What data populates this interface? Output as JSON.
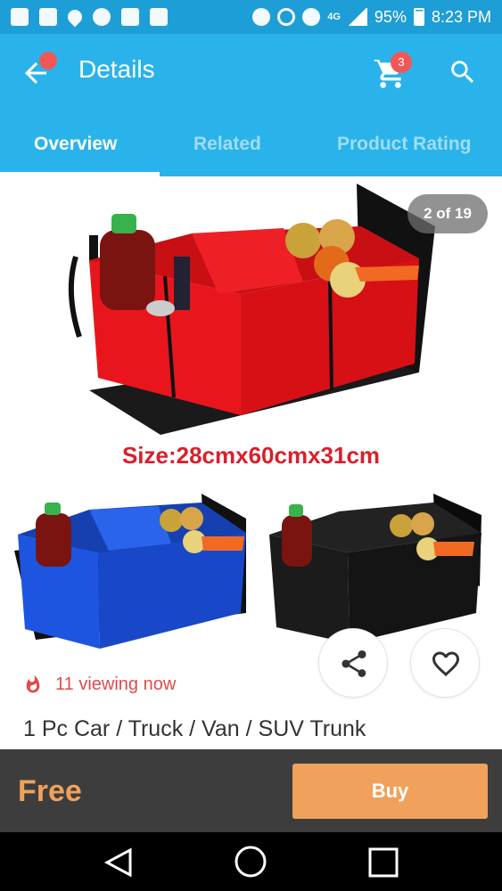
{
  "status_bar": {
    "network": "4G",
    "battery": "95%",
    "time": "8:23 PM"
  },
  "app_bar": {
    "title": "Details",
    "cart_count": "3",
    "icons": [
      "back-arrow-icon",
      "cart-icon",
      "search-icon"
    ]
  },
  "tabs": [
    {
      "label": "Overview",
      "active": true
    },
    {
      "label": "Related",
      "active": false
    },
    {
      "label": "Product Rating",
      "active": false
    }
  ],
  "gallery": {
    "counter": "2 of 19",
    "image_caption": "Size:28cmx60cmx31cm"
  },
  "product": {
    "viewing_now": "11 viewing now",
    "title": "1 Pc Car / Truck / Van / SUV Trunk"
  },
  "purchase": {
    "price": "Free",
    "buy_label": "Buy"
  },
  "colors": {
    "status_bar": "#1e9ed6",
    "app_bar": "#2ab3ea",
    "accent_orange": "#f0a15b",
    "badge_red": "#f25757",
    "caption_red": "#d9202b",
    "organizer_red": "#e8161c",
    "organizer_blue": "#1b4fd6",
    "organizer_black": "#151515"
  }
}
